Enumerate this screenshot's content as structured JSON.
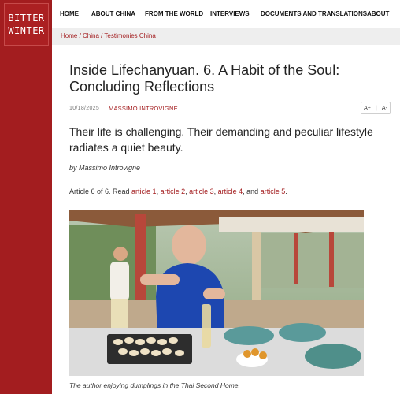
{
  "logo": {
    "line1": "BITTER",
    "line2": "WINTER"
  },
  "nav": {
    "items": [
      {
        "label": "HOME"
      },
      {
        "label": "ABOUT CHINA"
      },
      {
        "label": "FROM THE WORLD"
      },
      {
        "label": "INTERVIEWS"
      },
      {
        "label": "DOCUMENTS AND TRANSLATIONS"
      },
      {
        "label": "ABOUT"
      }
    ]
  },
  "breadcrumb": {
    "text": "Home / China / Testimonies China"
  },
  "article": {
    "title": "Inside Lifechanyuan. 6. A Habit of the Soul: Concluding Reflections",
    "date": "10/18/2025",
    "author": "MASSIMO INTROVIGNE",
    "font_increase": "A+",
    "font_decrease": "A-",
    "lead": "Their life is challenging. Their demanding and peculiar lifestyle radiates a quiet beauty.",
    "byline": "by Massimo Introvigne",
    "series_prefix": "Article 6 of 6. Read ",
    "links": [
      "article 1",
      "article 2",
      "article 3",
      "article 4",
      "article 5"
    ],
    "and_word": "and",
    "caption": "The author enjoying dumplings in the Thai Second Home."
  },
  "colors": {
    "brand": "#a31d1f",
    "nav_bg": "#ffffff",
    "crumb_bg": "#eeeeee"
  }
}
